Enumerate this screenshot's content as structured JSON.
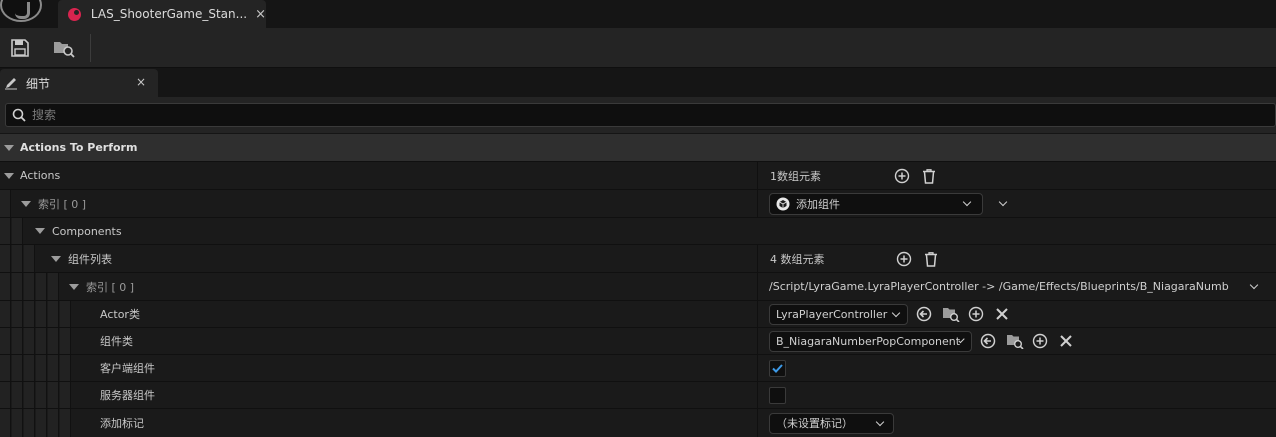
{
  "window": {
    "doc_tab_label": "LAS_ShooterGame_Stan...",
    "doc_tab_close": "×"
  },
  "panel": {
    "tab_label": "细节",
    "tab_close": "×"
  },
  "search": {
    "placeholder": "搜索"
  },
  "category": {
    "title": "Actions To Perform"
  },
  "rows": {
    "actions": {
      "label": "Actions",
      "value": "1数组元素"
    },
    "index0": {
      "label": "索引 [ 0 ]",
      "combo": "添加组件"
    },
    "components": {
      "label": "Components"
    },
    "component_list": {
      "label": "组件列表",
      "value": "4 数组元素"
    },
    "comp_index0": {
      "label": "索引 [ 0 ]",
      "value": "/Script/LyraGame.LyraPlayerController -> /Game/Effects/Blueprints/B_NiagaraNumberPop"
    },
    "actor_class": {
      "label": "Actor类",
      "combo": "LyraPlayerController"
    },
    "component_class": {
      "label": "组件类",
      "combo": "B_NiagaraNumberPopComponent"
    },
    "client_component": {
      "label": "客户端组件",
      "checked": true
    },
    "server_component": {
      "label": "服务器组件",
      "checked": false
    },
    "add_tag": {
      "label": "添加标记",
      "combo": "（未设置标记）"
    }
  },
  "colors": {
    "accent_tab_icon": "#d8244f",
    "checkbox_check": "#3d9ae8"
  }
}
